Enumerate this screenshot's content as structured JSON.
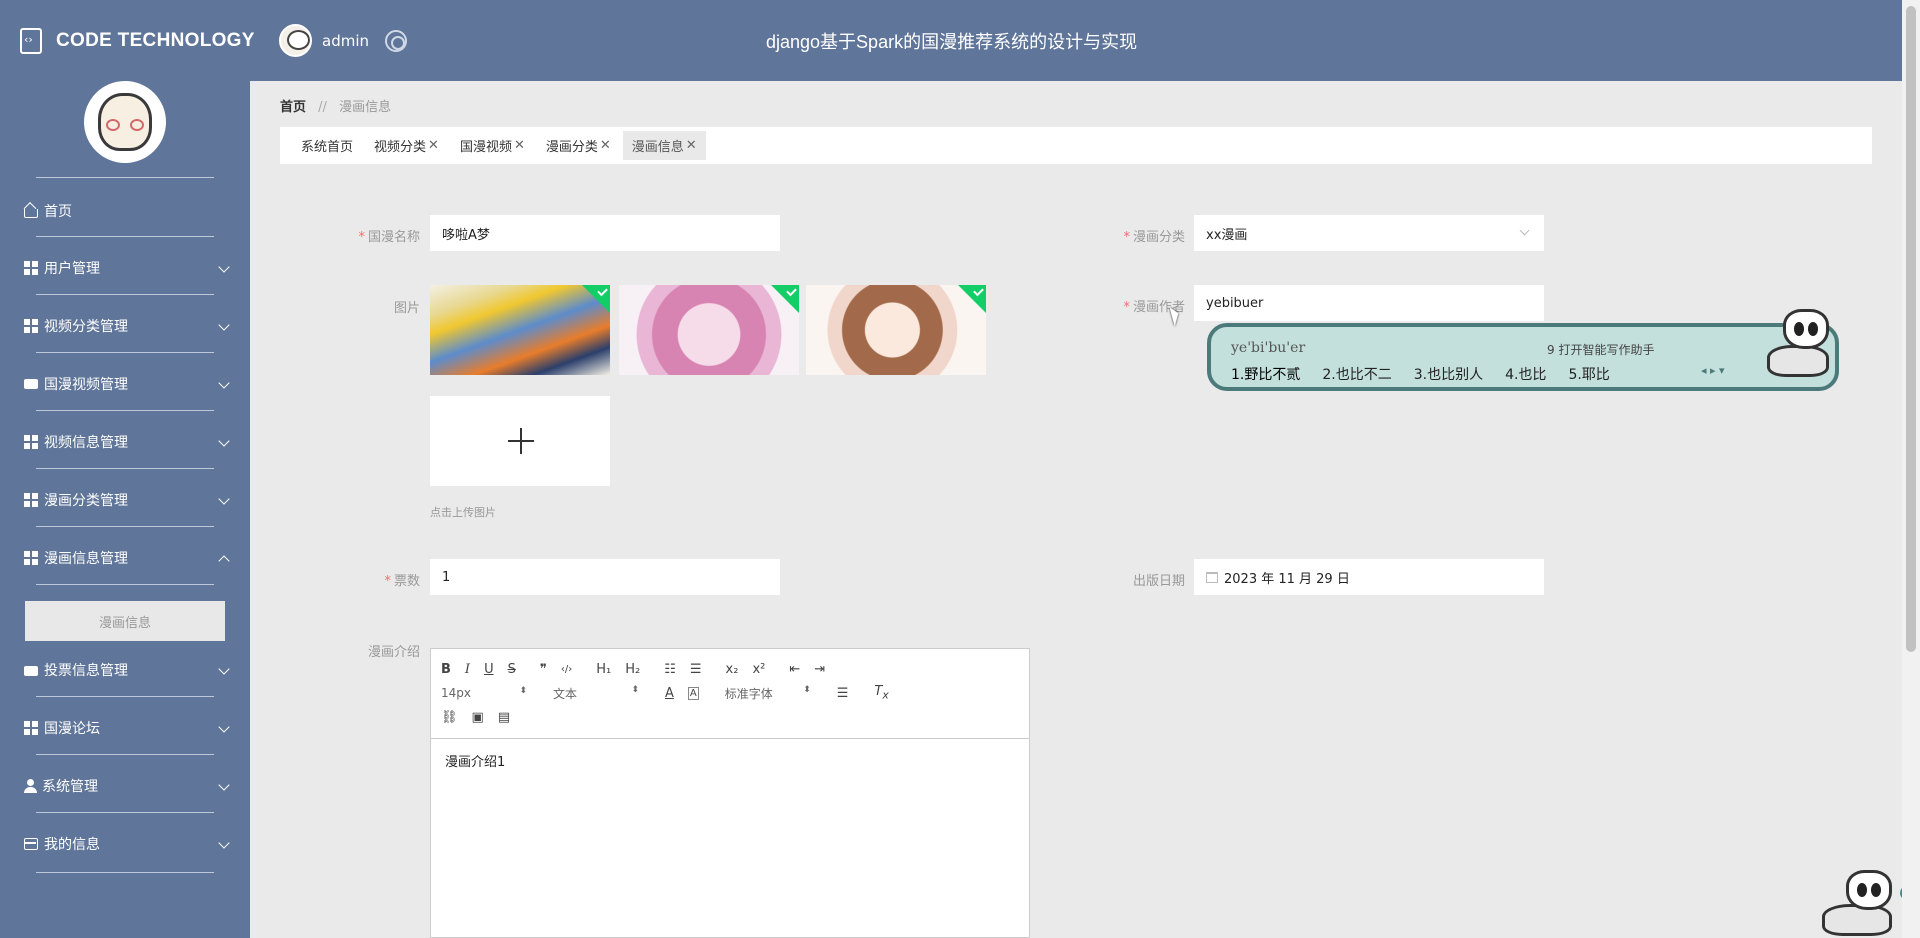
{
  "header": {
    "logo_text": "CODE TECHNOLOGY",
    "username": "admin",
    "site_title": "django基于Spark的国漫推荐系统的设计与实现"
  },
  "sidebar": {
    "items": [
      {
        "label": "首页",
        "icon": "home-icon"
      },
      {
        "label": "用户管理",
        "icon": "grid-icon"
      },
      {
        "label": "视频分类管理",
        "icon": "grid-icon"
      },
      {
        "label": "国漫视频管理",
        "icon": "chat-icon"
      },
      {
        "label": "视频信息管理",
        "icon": "grid-icon"
      },
      {
        "label": "漫画分类管理",
        "icon": "grid-icon"
      },
      {
        "label": "漫画信息管理",
        "icon": "grid-icon"
      },
      {
        "label": "投票信息管理",
        "icon": "vote-icon"
      },
      {
        "label": "国漫论坛",
        "icon": "grid-icon"
      },
      {
        "label": "系统管理",
        "icon": "user-icon"
      },
      {
        "label": "我的信息",
        "icon": "card-icon"
      }
    ],
    "active_sub_item": "漫画信息"
  },
  "breadcrumb": {
    "home": "首页",
    "separator": "//",
    "current": "漫画信息"
  },
  "tabs": [
    {
      "label": "系统首页",
      "closable": false
    },
    {
      "label": "视频分类",
      "closable": true
    },
    {
      "label": "国漫视频",
      "closable": true
    },
    {
      "label": "漫画分类",
      "closable": true
    },
    {
      "label": "漫画信息",
      "closable": true
    }
  ],
  "tab_close_glyph": "✕",
  "form": {
    "name_label": "国漫名称",
    "name_value": "哆啦A梦",
    "category_label": "漫画分类",
    "category_value": "xx漫画",
    "image_label": "图片",
    "upload_tip": "点击上传图片",
    "author_label": "漫画作者",
    "author_value": "yebibuer",
    "votes_label": "票数",
    "votes_value": "1",
    "date_label": "出版日期",
    "date_value": "2023 年 11 月 29 日",
    "intro_label": "漫画介绍",
    "intro_value": "漫画介绍1",
    "required_mark": "*"
  },
  "editor": {
    "font_size": "14px",
    "block_type": "文本",
    "font_family": "标准字体",
    "buttons_row1": [
      "B",
      "I",
      "U",
      "S",
      "❞",
      "‹/›",
      "H₁",
      "H₂",
      "☷",
      "☰",
      "x₂",
      "x²",
      "⇤",
      "⇥"
    ],
    "buttons_row3": [
      "⛓",
      "▣",
      "▤"
    ]
  },
  "ime": {
    "pinyin": "ye'bi'bu'er",
    "helper": "9 打开智能写作助手",
    "candidates": [
      "1.野比不贰",
      "2.也比不二",
      "3.也比别人",
      "4.也比",
      "5.耶比"
    ],
    "arrows": "◂ ▸ ▾"
  },
  "colors": {
    "sidebar_bg": "#5f7599",
    "tab_active_bg": "#e9e9e9",
    "upload_success_corner": "#13ce66",
    "required": "#f56c6c"
  }
}
